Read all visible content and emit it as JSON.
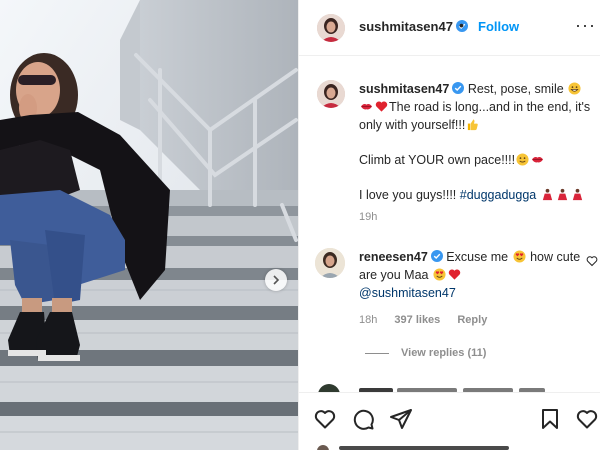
{
  "post": {
    "username": "sushmitasen47",
    "follow_label": "Follow",
    "separator": "•",
    "more_label": "···"
  },
  "caption": {
    "username": "sushmitasen47",
    "line1": "Rest, pose, smile",
    "line2": "The road is long...and in the end, it's only with yourself!!!",
    "line3": "Climb at YOUR own pace!!!!",
    "line4": "I love you guys!!!! ",
    "hashtag": "#duggadugga",
    "time": "19h"
  },
  "comment": {
    "username": "reneesen47",
    "text1": "Excuse me",
    "text2": "how cute are you Maa",
    "mention": "@sushmitasen47",
    "time": "18h",
    "likes": "397 likes",
    "reply_label": "Reply",
    "view_replies": "View replies (11)"
  },
  "icons": {
    "verified": "verified-badge-icon",
    "like": "heart-outline-icon",
    "comment": "comment-bubble-icon",
    "share": "paper-plane-icon",
    "save": "bookmark-icon",
    "next": "chevron-right-icon"
  },
  "colors": {
    "link_blue": "#0095f6",
    "hashtag_blue": "#00376b",
    "muted": "#8e8e8e",
    "text": "#262626"
  }
}
